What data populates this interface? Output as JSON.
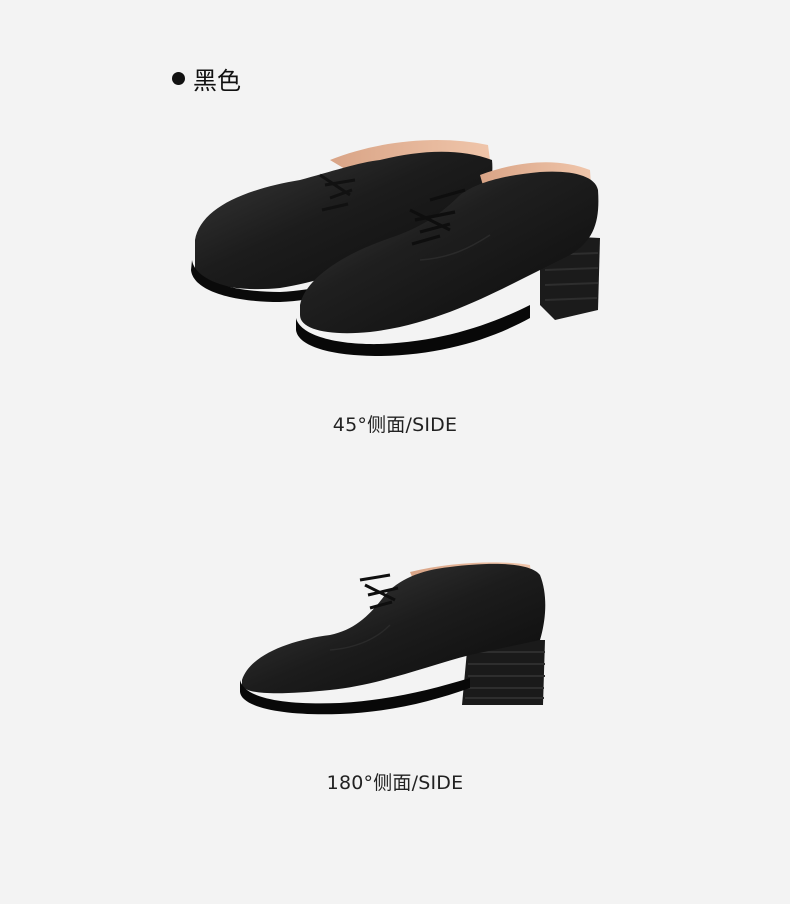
{
  "variant": {
    "color_name": "黑色"
  },
  "views": [
    {
      "caption": "45°侧面/SIDE"
    },
    {
      "caption": "180°侧面/SIDE"
    }
  ],
  "colors": {
    "background": "#f3f3f3",
    "leather": "#1a1a1a",
    "lining": "#e8b89c"
  }
}
